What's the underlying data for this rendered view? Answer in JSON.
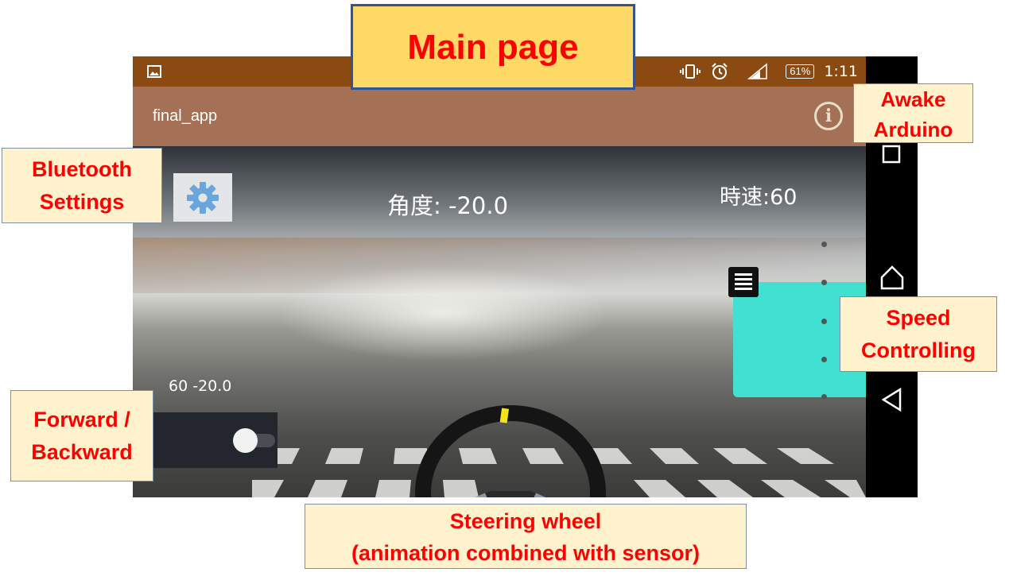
{
  "page_title": "Main page",
  "status_bar": {
    "time": "1:11",
    "battery": "61%"
  },
  "app_bar": {
    "title": "final_app"
  },
  "hud": {
    "angle": "角度: -20.0",
    "speed": "時速:60",
    "values": "60 -20.0"
  },
  "annotations": {
    "awake_line1": "Awake",
    "awake_line2": "Arduino",
    "bluetooth_line1": "Bluetooth",
    "bluetooth_line2": "Settings",
    "speed_line1": "Speed",
    "speed_line2": "Controlling",
    "forward_line1": "Forward /",
    "forward_line2": "Backward",
    "steering_line1": "Steering wheel",
    "steering_line2": "(animation combined with sensor)"
  },
  "icons": [
    "image-icon",
    "vibrate-icon",
    "alarm-icon",
    "signal-icon",
    "battery-icon",
    "info-icon",
    "gear-icon",
    "slider-handle-icon",
    "recents-icon",
    "home-icon",
    "back-icon"
  ],
  "colors": {
    "status_bar": "#8b4a12",
    "app_bar": "#a57156",
    "speed_panel": "#41e0d0",
    "annotation_bg": "#fff2cc",
    "annotation_text": "#ff0000",
    "title_bg": "#ffd966",
    "title_border": "#2f5597"
  }
}
